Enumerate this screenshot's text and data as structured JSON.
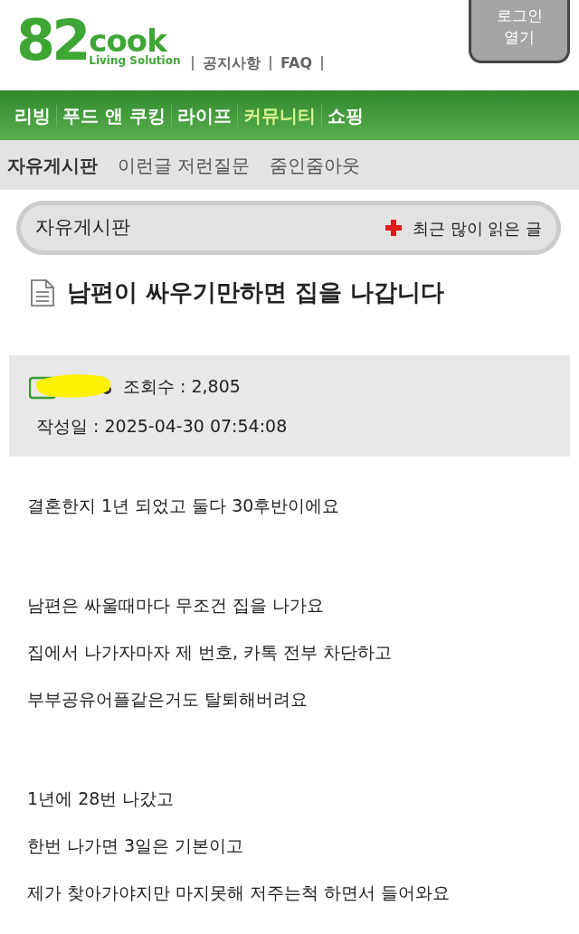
{
  "header": {
    "logo": {
      "number": "82",
      "word": "cook",
      "tagline": "Living Solution"
    },
    "links": [
      "공지사항",
      "FAQ"
    ],
    "login_button": [
      "로그인",
      "열기"
    ]
  },
  "main_nav": [
    {
      "label": "리빙",
      "selected": false
    },
    {
      "label": "푸드 앤 쿠킹",
      "selected": false
    },
    {
      "label": "라이프",
      "selected": false
    },
    {
      "label": "커뮤니티",
      "selected": true
    },
    {
      "label": "쇼핑",
      "selected": false
    }
  ],
  "sub_nav": [
    {
      "label": "자유게시판",
      "selected": true
    },
    {
      "label": "이런글 저런질문",
      "selected": false
    },
    {
      "label": "줌인줌아웃",
      "selected": false
    }
  ],
  "board_bar": {
    "title": "자유게시판",
    "link": "최근 많이 읽은 글"
  },
  "post": {
    "title": "남편이 싸우기만하면 집을 나갑니다",
    "views": "조회수 : 2,805",
    "date": "작성일 : 2025-04-30 07:54:08",
    "paragraphs": [
      [
        "결혼한지 1년 되었고 둘다 30후반이에요"
      ],
      [
        "남편은 싸울때마다 무조건 집을 나가요",
        "집에서 나가자마자 제 번호, 카톡 전부 차단하고",
        "부부공유어플같은거도 탈퇴해버려요"
      ],
      [
        "1년에 28번 나갔고",
        "한번 나가면 3일은 기본이고",
        "제가 찾아가야지만 마지못해 저주는척 하면서 들어와요"
      ]
    ]
  }
}
